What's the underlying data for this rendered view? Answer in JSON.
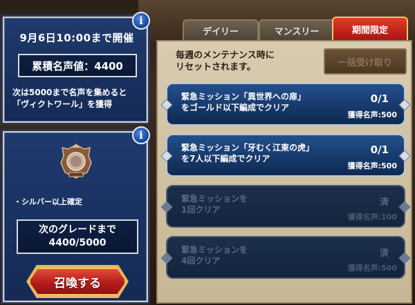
{
  "event": {
    "period": "9月6日10:00まで開催",
    "fame_total": "累積名声値：4400",
    "description_line1": "次は5000まで名声を集めると",
    "description_line2": "「ヴィクトワール」を獲得"
  },
  "grade": {
    "note": "・シルバー以上確定",
    "next_label": "次のグレードまで",
    "next_value": "4400/5000",
    "summon_label": "召喚する"
  },
  "tabs": [
    {
      "label": "デイリー",
      "active": false
    },
    {
      "label": "マンスリー",
      "active": false
    },
    {
      "label": "期間限定",
      "active": true
    }
  ],
  "missions_panel": {
    "reset_line1": "毎週のメンテナンス時に",
    "reset_line2": "リセットされます。",
    "claim_all_label": "一括受け取り"
  },
  "missions": [
    {
      "line1": "緊急ミッション「異世界への扉」",
      "line2": "をゴールド以下編成でクリア",
      "progress": "0/1",
      "reward": "獲得名声:500",
      "status": "active"
    },
    {
      "line1": "緊急ミッション「牙むく江東の虎」",
      "line2": "を7人以下編成でクリア",
      "progress": "0/1",
      "reward": "獲得名声:500",
      "status": "active"
    },
    {
      "line1": "緊急ミッションを",
      "line2": "1回クリア",
      "progress": "済",
      "reward": "獲得名声:100",
      "status": "done"
    },
    {
      "line1": "緊急ミッションを",
      "line2": "4回クリア",
      "progress": "済",
      "reward": "獲得名声:500",
      "status": "done"
    }
  ],
  "colors": {
    "panel_blue": "#1f3a6e",
    "active_tab_red": "#e53a2a",
    "summon_red": "#b51d1a",
    "mission_blue": "#244f8c",
    "parchment": "#d8cbb0"
  }
}
